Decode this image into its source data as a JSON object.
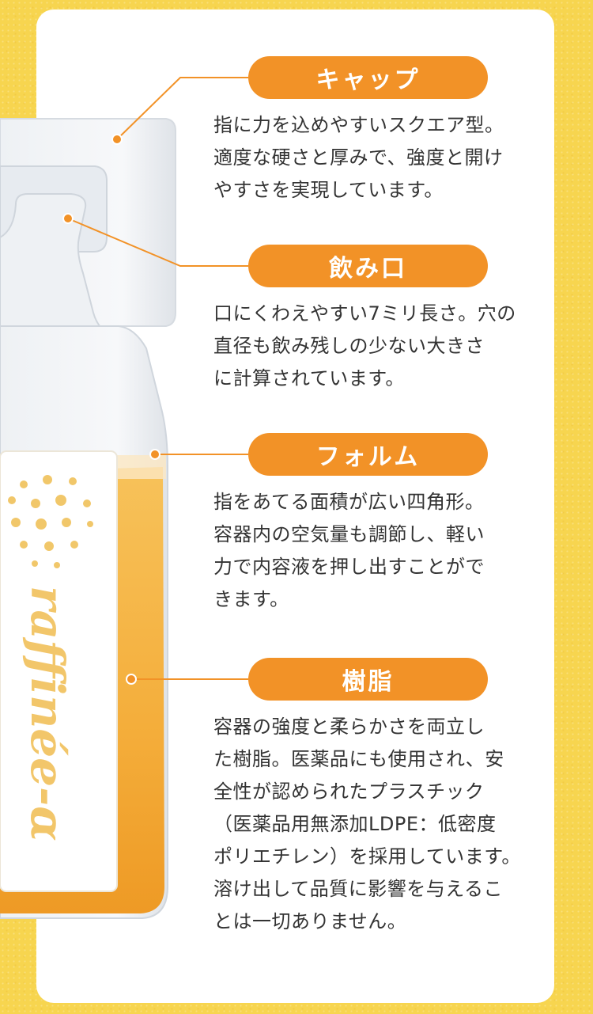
{
  "colors": {
    "accent": "#f29227",
    "background": "#f7d54f",
    "text": "#333333"
  },
  "features": [
    {
      "title": "キャップ",
      "description": "指に力を込めやすいスクエア型。\n適度な硬さと厚みで、強度と開け\nやすさを実現しています。"
    },
    {
      "title": "飲み口",
      "description": "口にくわえやすい7ミリ長さ。穴の\n直径も飲み残しの少ない大きさ\nに計算されています。"
    },
    {
      "title": "フォルム",
      "description": "指をあてる面積が広い四角形。\n容器内の空気量も調節し、軽い\n力で内容液を押し出すことがで\nきます。"
    },
    {
      "title": "樹脂",
      "description": "容器の強度と柔らかさを両立し\nた樹脂。医薬品にも使用され、安\n全性が認められたプラスチック\n（医薬品用無添加LDPE：低密度\nポリエチレン）を採用しています。\n溶け出して品質に影響を与えるこ\nとは一切ありません。"
    }
  ],
  "product_label": {
    "brand": "raffinée-α"
  }
}
